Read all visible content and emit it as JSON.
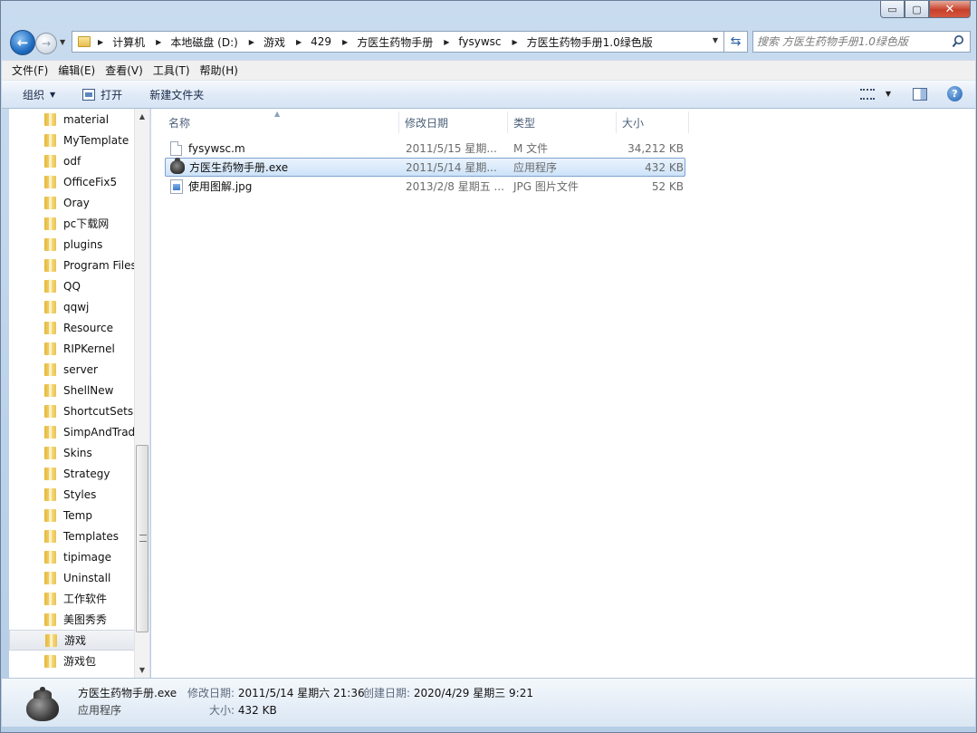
{
  "window": {
    "minimize_glyph": "▭",
    "maximize_glyph": "▢",
    "close_glyph": "✕"
  },
  "address": {
    "crumbs": [
      "计算机",
      "本地磁盘 (D:)",
      "游戏",
      "429",
      "方医生药物手册",
      "fysywsc",
      "方医生药物手册1.0绿色版"
    ],
    "search_placeholder": "搜索 方医生药物手册1.0绿色版"
  },
  "menubar": {
    "items": [
      "文件(F)",
      "编辑(E)",
      "查看(V)",
      "工具(T)",
      "帮助(H)"
    ]
  },
  "toolbar": {
    "organize": "组织",
    "open": "打开",
    "new_folder": "新建文件夹"
  },
  "nav": {
    "items": [
      "material",
      "MyTemplate",
      "odf",
      "OfficeFix5",
      "Oray",
      "pc下载网",
      "plugins",
      "Program Files",
      "QQ",
      "qqwj",
      "Resource",
      "RIPKernel",
      "server",
      "ShellNew",
      "ShortcutSets",
      "SimpAndTrad",
      "Skins",
      "Strategy",
      "Styles",
      "Temp",
      "Templates",
      "tipimage",
      "Uninstall",
      "工作软件",
      "美图秀秀",
      "游戏",
      "游戏包"
    ],
    "selected": "游戏"
  },
  "columns": {
    "name": "名称",
    "date": "修改日期",
    "type": "类型",
    "size": "大小"
  },
  "files": [
    {
      "name": "fysywsc.m",
      "date": "2011/5/15 星期...",
      "type": "M 文件",
      "size": "34,212 KB",
      "icon": "document-icon"
    },
    {
      "name": "方医生药物手册.exe",
      "date": "2011/5/14 星期...",
      "type": "应用程序",
      "size": "432 KB",
      "icon": "kettle-app-icon"
    },
    {
      "name": "使用图解.jpg",
      "date": "2013/2/8 星期五 ...",
      "type": "JPG 图片文件",
      "size": "52 KB",
      "icon": "image-file-icon"
    }
  ],
  "details": {
    "name": "方医生药物手册.exe",
    "type": "应用程序",
    "modified_label": "修改日期:",
    "modified_value": "2011/5/14 星期六 21:36",
    "created_label": "创建日期:",
    "created_value": "2020/4/29 星期三 9:21",
    "size_label": "大小:",
    "size_value": "432 KB"
  }
}
